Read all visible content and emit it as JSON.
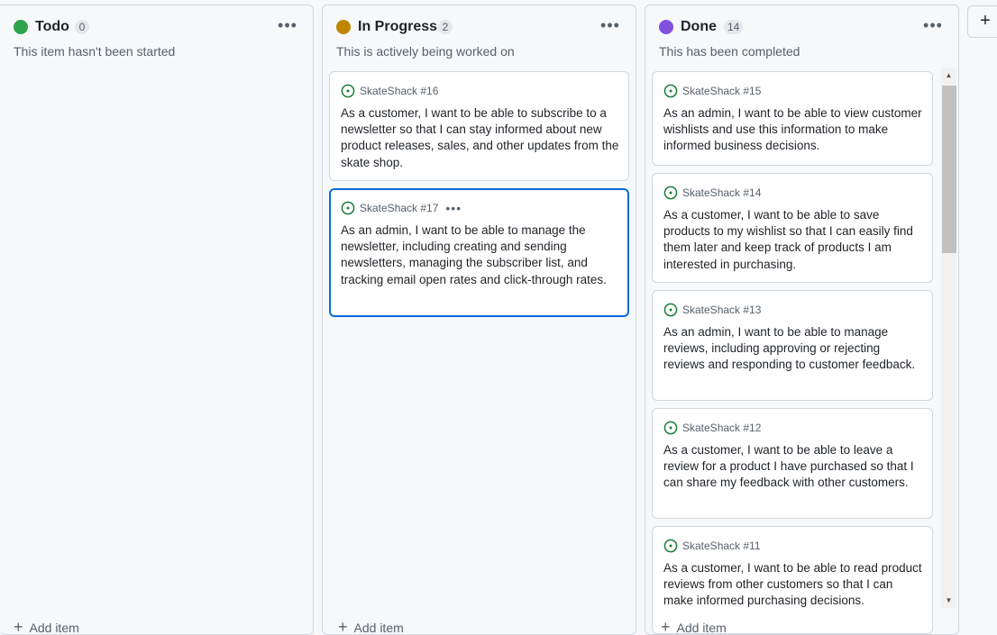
{
  "columns": [
    {
      "title": "Todo",
      "count": "0",
      "color": "#2da44e",
      "description": "This item hasn't been started",
      "menu": "•••",
      "add_label": "Add item",
      "cards": []
    },
    {
      "title": "In Progress",
      "count": "2",
      "color": "#bf8700",
      "description": "This is actively being worked on",
      "menu": "•••",
      "add_label": "Add item",
      "cards": [
        {
          "ref": "SkateShack #16",
          "title": "As a customer, I want to be able to subscribe to a newsletter so that I can stay informed about new product releases, sales, and other updates from the skate shop."
        },
        {
          "ref": "SkateShack #17",
          "menu": "•••",
          "title": "As an admin, I want to be able to manage the newsletter, including creating and sending newsletters, managing the subscriber list, and tracking email open rates and click-through rates."
        }
      ]
    },
    {
      "title": "Done",
      "count": "14",
      "color": "#8250df",
      "description": "This has been completed",
      "menu": "•••",
      "add_label": "Add item",
      "cards": [
        {
          "ref": "SkateShack #15",
          "title": "As an admin, I want to be able to view customer wishlists and use this information to make informed business decisions."
        },
        {
          "ref": "SkateShack #14",
          "title": "As a customer, I want to be able to save products to my wishlist so that I can easily find them later and keep track of products I am interested in purchasing."
        },
        {
          "ref": "SkateShack #13",
          "title": "As an admin, I want to be able to manage reviews, including approving or rejecting reviews and responding to customer feedback."
        },
        {
          "ref": "SkateShack #12",
          "title": "As a customer, I want to be able to leave a review for a product I have purchased so that I can share my feedback with other customers."
        },
        {
          "ref": "SkateShack #11",
          "title": "As a customer, I want to be able to read product reviews from other customers so that I can make informed purchasing decisions."
        }
      ]
    }
  ],
  "issue_icon_color": "#1a7f37",
  "selected_border_color": "#0969da",
  "new_column_label": "+"
}
